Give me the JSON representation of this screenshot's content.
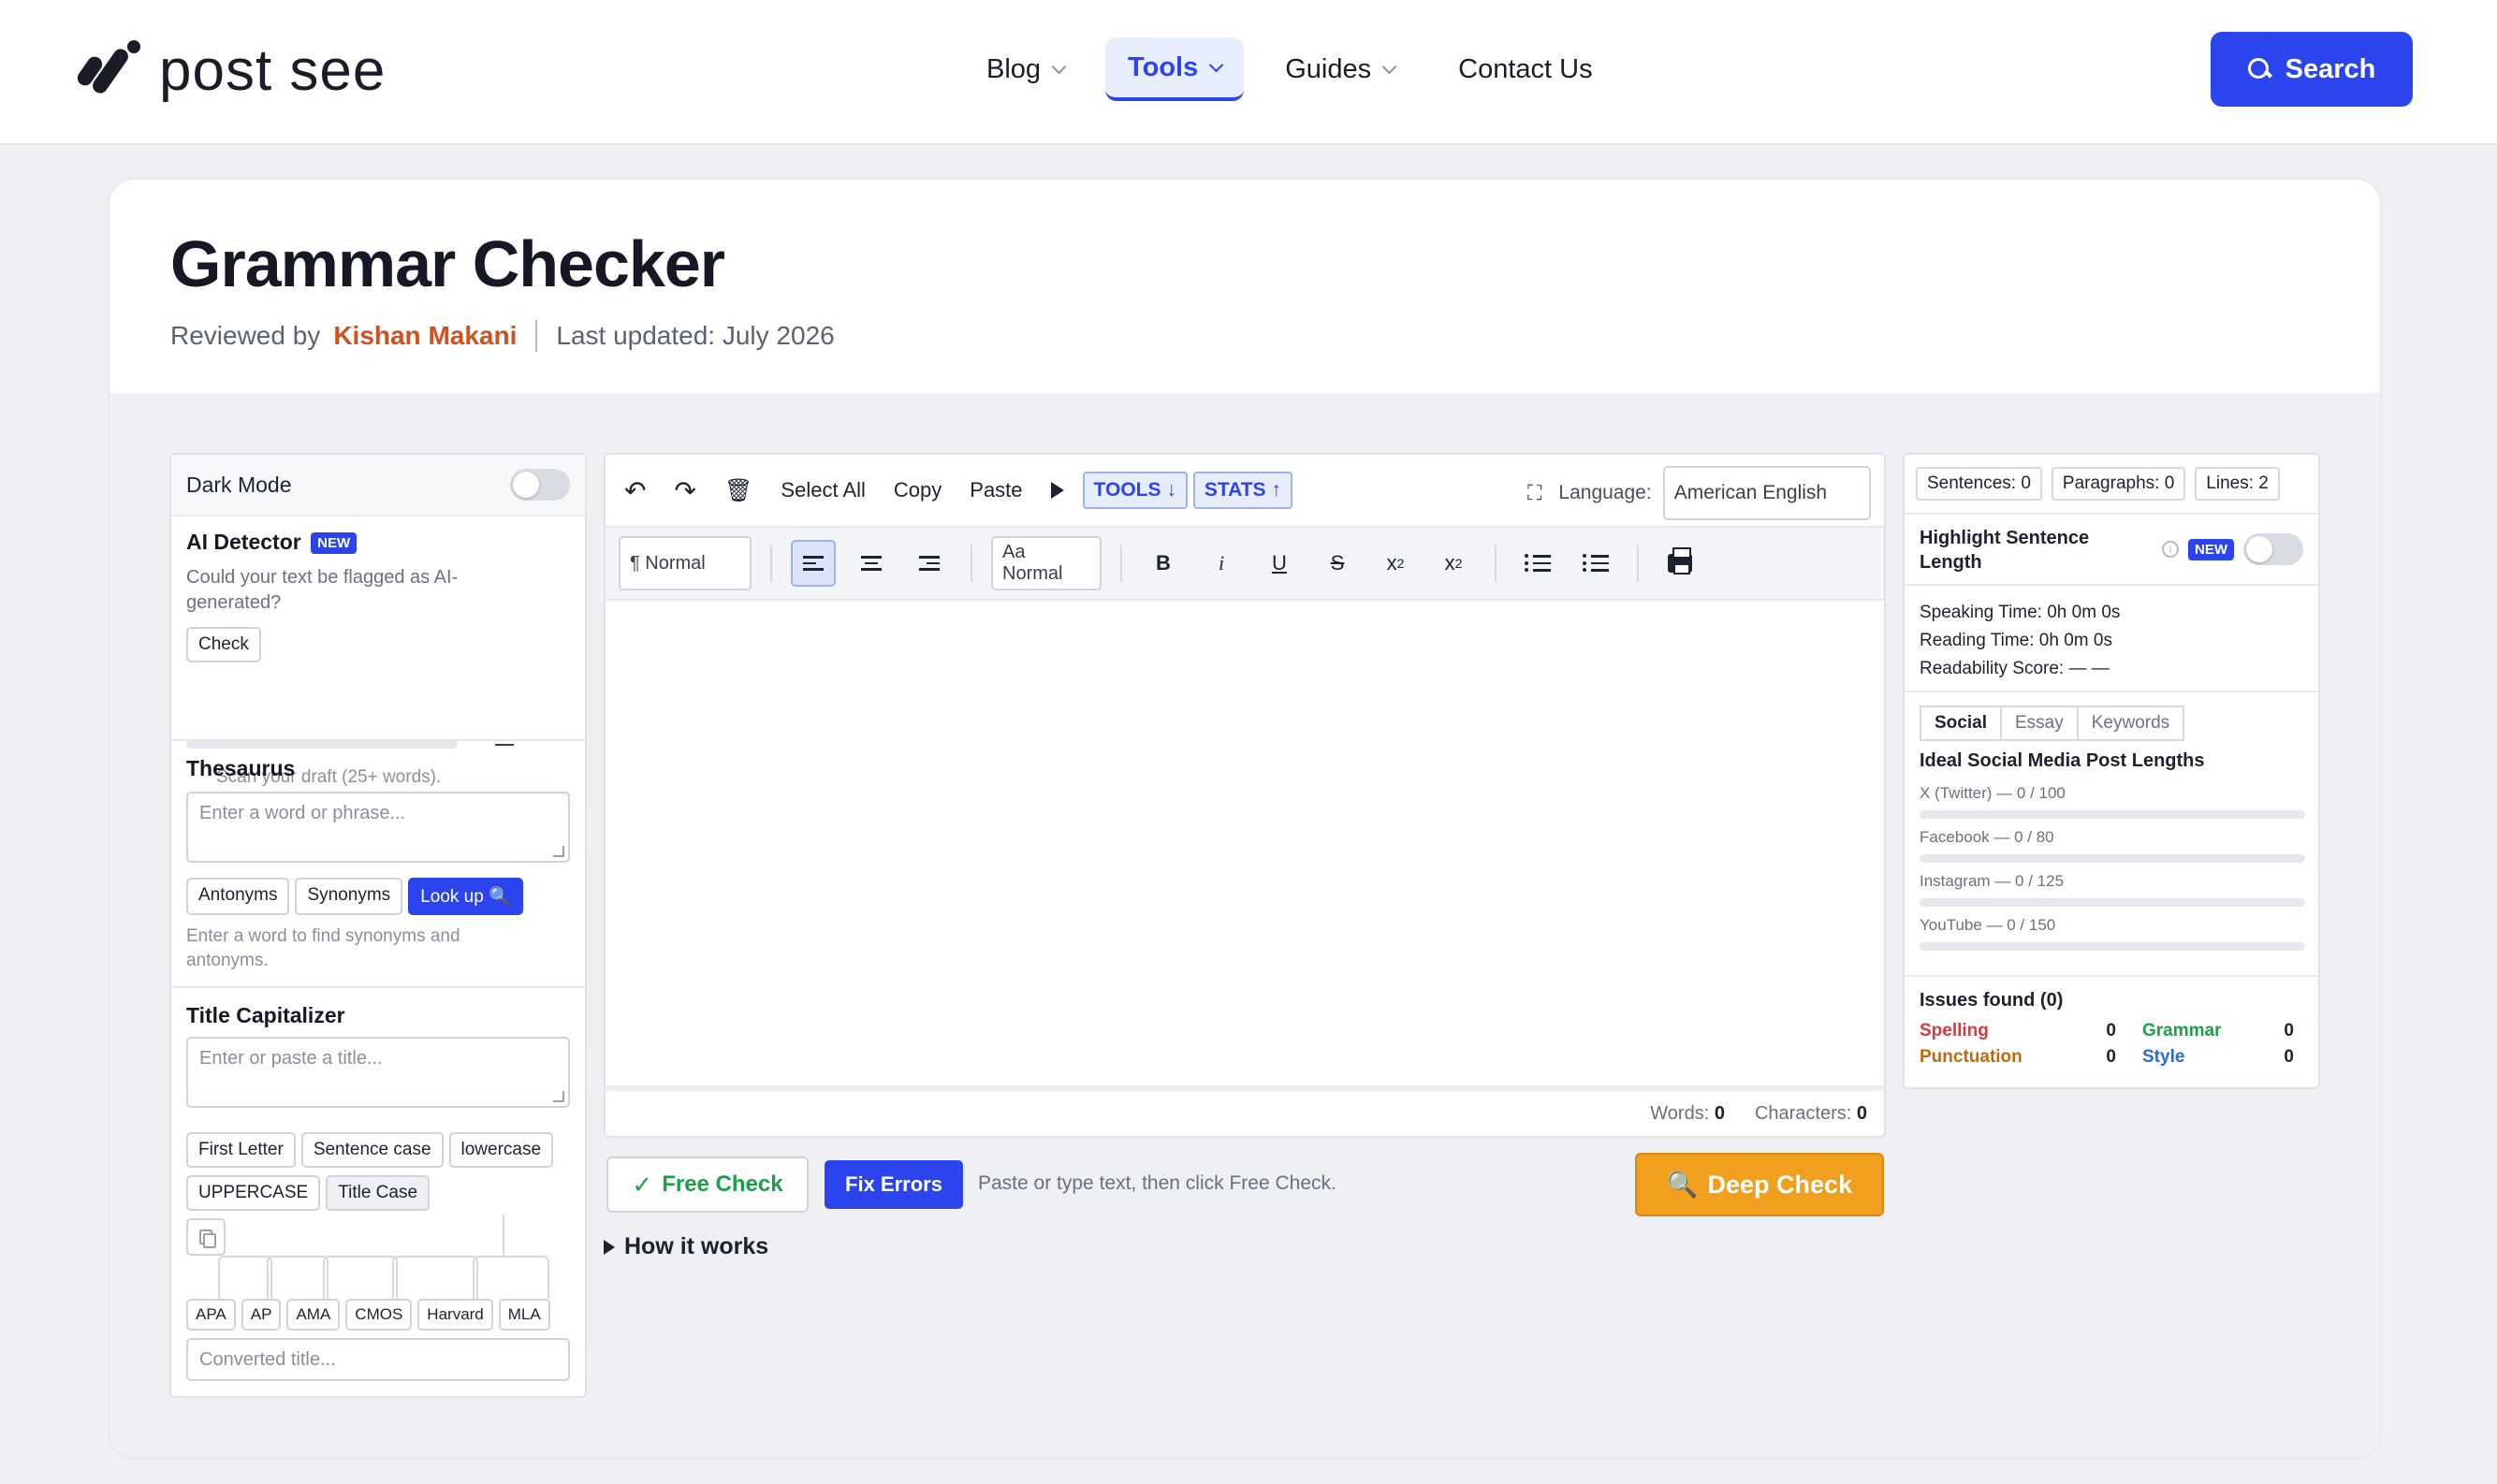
{
  "brand": {
    "name": "post see"
  },
  "nav": {
    "items": [
      {
        "label": "Blog"
      },
      {
        "label": "Tools"
      },
      {
        "label": "Guides"
      },
      {
        "label": "Contact Us"
      }
    ],
    "search_label": "Search"
  },
  "page": {
    "title": "Grammar Checker",
    "reviewed_prefix": "Reviewed by",
    "author": "Kishan Makani",
    "updated": "Last updated: July 2026"
  },
  "left": {
    "dark_mode": "Dark Mode",
    "ai": {
      "title": "AI Detector",
      "badge": "NEW",
      "desc": "Could your text be flagged as AI-generated?",
      "check": "Check",
      "scan": "Scan your draft (25+ words)."
    },
    "thesaurus": {
      "title": "Thesaurus",
      "placeholder": "Enter a word or phrase...",
      "antonyms": "Antonyms",
      "synonyms": "Synonyms",
      "lookup": "Look up 🔍",
      "hint": "Enter a word to find synonyms and antonyms."
    },
    "capitalizer": {
      "title": "Title Capitalizer",
      "placeholder": "Enter or paste a title...",
      "cases": [
        "First Letter",
        "Sentence case",
        "lowercase",
        "UPPERCASE",
        "Title Case"
      ],
      "styles": [
        "APA",
        "AP",
        "AMA",
        "CMOS",
        "Harvard",
        "MLA"
      ],
      "output_placeholder": "Converted title..."
    }
  },
  "editor": {
    "toolbar": {
      "select_all": "Select All",
      "copy": "Copy",
      "paste": "Paste",
      "tools": "TOOLS ↓",
      "stats": "STATS ↑",
      "language_label": "Language:",
      "language_value": "American English",
      "block_format": "¶ Normal",
      "font_size": "Aa Normal"
    },
    "words_label": "Words:",
    "words": "0",
    "chars_label": "Characters:",
    "chars": "0"
  },
  "actions": {
    "free_check": "Free Check",
    "fix_errors": "Fix Errors",
    "hint": "Paste or type text, then click Free Check.",
    "deep_check": "Deep Check",
    "how_it_works": "How it works"
  },
  "stats": {
    "sentences": "Sentences: 0",
    "paragraphs": "Paragraphs: 0",
    "lines": "Lines: 2",
    "highlight": "Highlight Sentence Length",
    "badge": "NEW",
    "speaking": "Speaking Time: 0h 0m 0s",
    "reading": "Reading Time: 0h 0m 0s",
    "readability": "Readability Score: — —",
    "tabs": [
      "Social",
      "Essay",
      "Keywords"
    ],
    "ideal_title": "Ideal Social Media Post Lengths",
    "platforms": [
      {
        "label": "X (Twitter) — 0 / 100",
        "fraction": 0
      },
      {
        "label": "Facebook — 0 / 80",
        "fraction": 0
      },
      {
        "label": "Instagram — 0 / 125",
        "fraction": 0
      },
      {
        "label": "YouTube — 0 / 150",
        "fraction": 0
      }
    ],
    "issues_title": "Issues found (0)",
    "issues": {
      "spelling": "Spelling",
      "spelling_n": "0",
      "grammar": "Grammar",
      "grammar_n": "0",
      "punctuation": "Punctuation",
      "punctuation_n": "0",
      "style": "Style",
      "style_n": "0"
    }
  },
  "colors": {
    "accent": "#2b44ee",
    "author": "#d1501f",
    "free_check": "#1e9e4a",
    "deep_check": "#f0a01e",
    "spelling": "#d63a3a",
    "grammar": "#1e9e4a",
    "punctuation": "#c26a0a",
    "style": "#2b68d8"
  }
}
